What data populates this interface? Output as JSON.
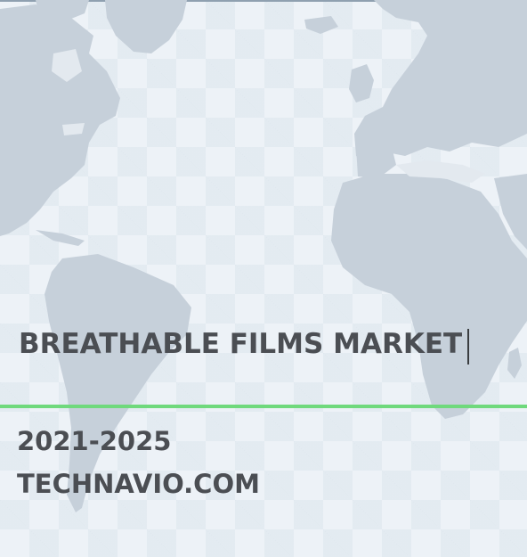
{
  "cover": {
    "title": "BREATHABLE FILMS MARKET",
    "years": "2021-2025",
    "website": "TECHNAVIO.COM",
    "colors": {
      "background": "#edf2f7",
      "map_land": "#c6d0da",
      "text": "#4b4e53",
      "divider": "#6fd97c"
    },
    "background_graphic": "world-map"
  }
}
